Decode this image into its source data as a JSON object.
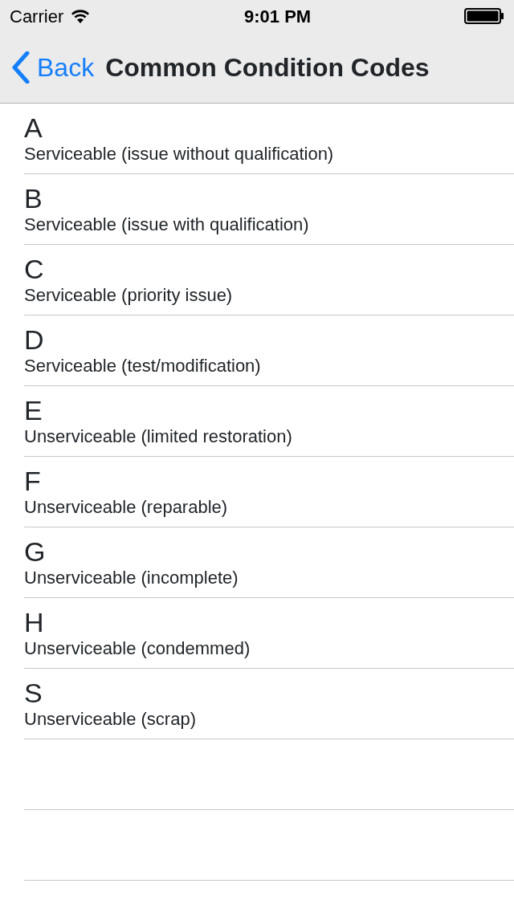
{
  "status_bar": {
    "carrier": "Carrier",
    "time": "9:01 PM"
  },
  "nav_bar": {
    "back": "Back",
    "title": "Common Condition Codes"
  },
  "rows": [
    {
      "code": "A",
      "description": "Serviceable (issue without qualification)"
    },
    {
      "code": "B",
      "description": "Serviceable (issue with qualification)"
    },
    {
      "code": "C",
      "description": "Serviceable (priority issue)"
    },
    {
      "code": "D",
      "description": "Serviceable (test/modification)"
    },
    {
      "code": "E",
      "description": "Unserviceable (limited restoration)"
    },
    {
      "code": "F",
      "description": "Unserviceable (reparable)"
    },
    {
      "code": "G",
      "description": "Unserviceable (incomplete)"
    },
    {
      "code": "H",
      "description": "Unserviceable (condemmed)"
    },
    {
      "code": "S",
      "description": "Unserviceable (scrap)"
    }
  ]
}
